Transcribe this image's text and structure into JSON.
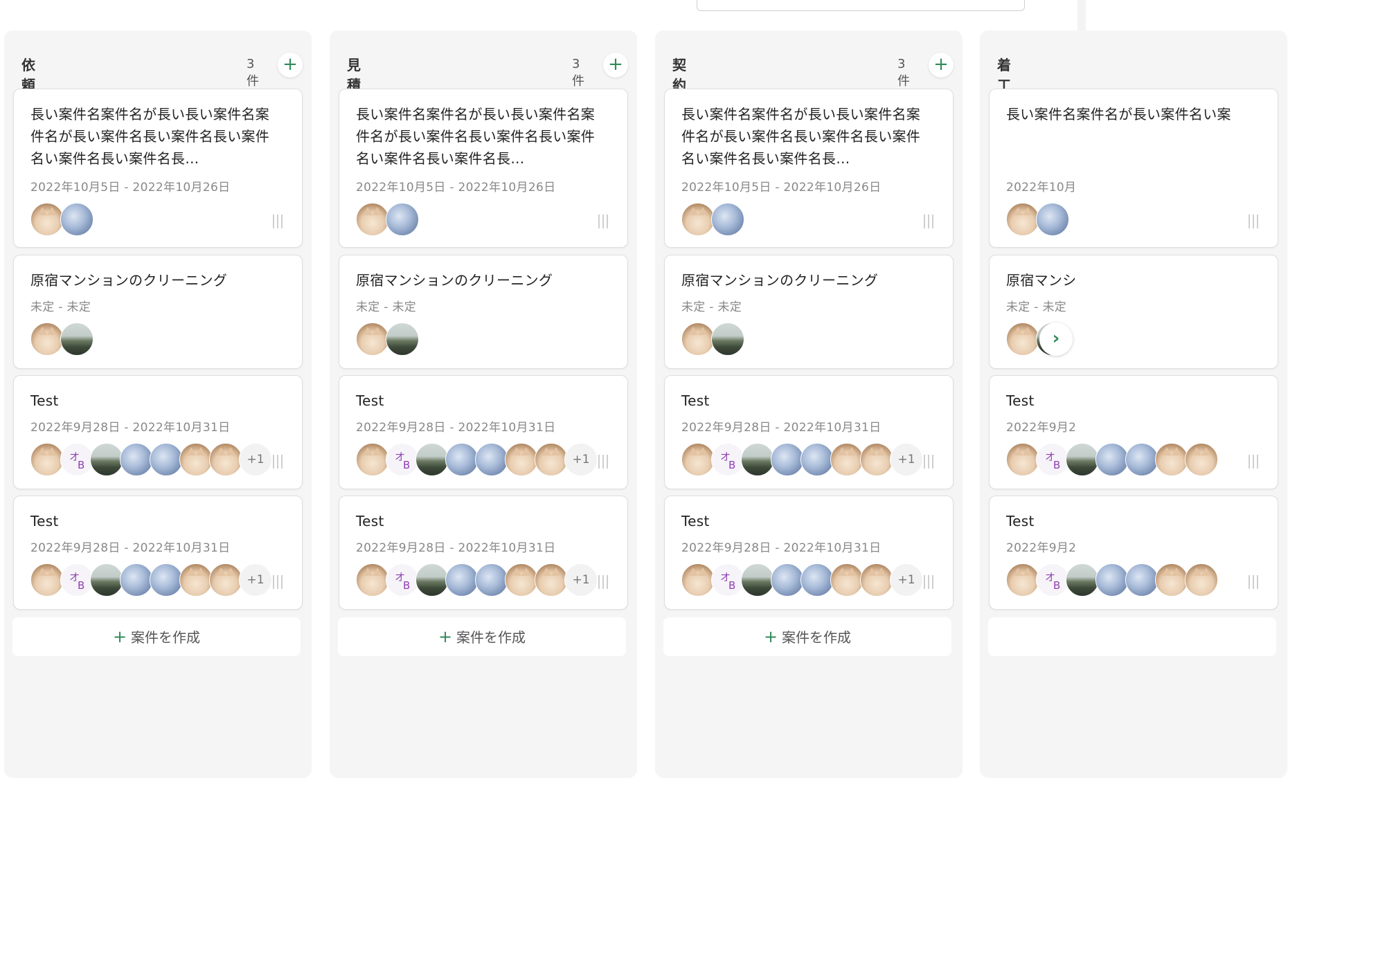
{
  "header": {},
  "columns": [
    {
      "title": "依頼受付",
      "count": "3件",
      "create_label": "案件を作成",
      "cards": [
        {
          "title": "長い案件名案件名が長い長い案件名案件名が長い案件名長い案件名長い案件名い案件名長い案件名長…",
          "date": "2022年10月5日 - 2022年10月26日",
          "more": ""
        },
        {
          "title": "原宿マンションのクリーニング",
          "date": "未定 - 未定",
          "more": ""
        },
        {
          "title": "Test",
          "date": "2022年9月28日 - 2022年10月31日",
          "more": "+1"
        },
        {
          "title": "Test",
          "date": "2022年9月28日 - 2022年10月31日",
          "more": "+1"
        }
      ]
    },
    {
      "title": "見積作成前",
      "count": "3件",
      "create_label": "案件を作成",
      "cards": [
        {
          "title": "長い案件名案件名が長い長い案件名案件名が長い案件名長い案件名長い案件名い案件名長い案件名長…",
          "date": "2022年10月5日 - 2022年10月26日",
          "more": ""
        },
        {
          "title": "原宿マンションのクリーニング",
          "date": "未定 - 未定",
          "more": ""
        },
        {
          "title": "Test",
          "date": "2022年9月28日 - 2022年10月31日",
          "more": "+1"
        },
        {
          "title": "Test",
          "date": "2022年9月28日 - 2022年10月31日",
          "more": "+1"
        }
      ]
    },
    {
      "title": "契約前",
      "count": "3件",
      "create_label": "案件を作成",
      "cards": [
        {
          "title": "長い案件名案件名が長い長い案件名案件名が長い案件名長い案件名長い案件名い案件名長い案件名長…",
          "date": "2022年10月5日 - 2022年10月26日",
          "more": ""
        },
        {
          "title": "原宿マンションのクリーニング",
          "date": "未定 - 未定",
          "more": ""
        },
        {
          "title": "Test",
          "date": "2022年9月28日 - 2022年10月31日",
          "more": "+1"
        },
        {
          "title": "Test",
          "date": "2022年9月28日 - 2022年10月31日",
          "more": "+1"
        }
      ]
    },
    {
      "title": "着工前",
      "count": "",
      "create_label": "",
      "cards": [
        {
          "title": "長い案件名案件名が長い案件名い案",
          "date": "2022年10月",
          "more": ""
        },
        {
          "title": "原宿マンシ",
          "date": "未定 - 未定",
          "more": ""
        },
        {
          "title": "Test",
          "date": "2022年9月2",
          "more": ""
        },
        {
          "title": "Test",
          "date": "2022年9月2",
          "more": ""
        }
      ]
    }
  ],
  "avatar_letter": {
    "kana": "オ",
    "latin": "B"
  },
  "icons": {
    "add": "plus-icon",
    "drag": "drag-handle-icon",
    "next": "chevron-right-icon"
  },
  "colors": {
    "accent": "#2e8b57",
    "column_bg": "#f5f5f5",
    "avatar_letter": "#9040b4"
  }
}
